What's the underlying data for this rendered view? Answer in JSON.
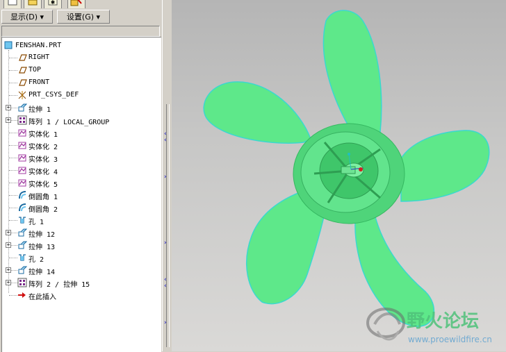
{
  "menus": {
    "display_label": "显示(D) ▾",
    "settings_label": "设置(G) ▾"
  },
  "tree": {
    "root": "FENSHAN.PRT",
    "items": [
      {
        "label": "RIGHT",
        "icon": "datum-plane-icon",
        "expandable": false
      },
      {
        "label": "TOP",
        "icon": "datum-plane-icon",
        "expandable": false
      },
      {
        "label": "FRONT",
        "icon": "datum-plane-icon",
        "expandable": false
      },
      {
        "label": "PRT_CSYS_DEF",
        "icon": "csys-icon",
        "expandable": false
      },
      {
        "label": "拉伸 1",
        "icon": "extrude-icon",
        "expandable": true
      },
      {
        "label": "阵列 1 / LOCAL_GROUP",
        "icon": "pattern-icon",
        "expandable": true
      },
      {
        "label": "实体化 1",
        "icon": "solidify-icon",
        "expandable": false
      },
      {
        "label": "实体化 2",
        "icon": "solidify-icon",
        "expandable": false
      },
      {
        "label": "实体化 3",
        "icon": "solidify-icon",
        "expandable": false
      },
      {
        "label": "实体化 4",
        "icon": "solidify-icon",
        "expandable": false
      },
      {
        "label": "实体化 5",
        "icon": "solidify-icon",
        "expandable": false
      },
      {
        "label": "倒圆角 1",
        "icon": "round-icon",
        "expandable": false
      },
      {
        "label": "倒圆角 2",
        "icon": "round-icon",
        "expandable": false
      },
      {
        "label": "孔 1",
        "icon": "hole-icon",
        "expandable": false
      },
      {
        "label": "拉伸 12",
        "icon": "extrude-icon",
        "expandable": true
      },
      {
        "label": "拉伸 13",
        "icon": "extrude-icon",
        "expandable": true
      },
      {
        "label": "孔 2",
        "icon": "hole-icon",
        "expandable": false
      },
      {
        "label": "拉伸 14",
        "icon": "extrude-icon",
        "expandable": true
      },
      {
        "label": "阵列 2 / 拉伸 15",
        "icon": "pattern-icon",
        "expandable": true
      },
      {
        "label": "在此插入",
        "icon": "insert-here-arrow-icon",
        "expandable": false
      }
    ]
  },
  "watermark": {
    "title": "野火论坛",
    "url": "www.proewildfire.cn"
  },
  "colors": {
    "part_green": "#5ee88a",
    "edge_cyan": "#40e0e0",
    "watermark_green": "#4fc27a"
  }
}
